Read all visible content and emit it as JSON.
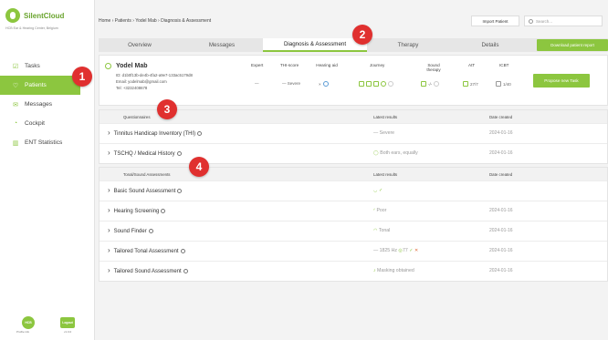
{
  "app": {
    "name": "SilentCloud",
    "subtitle": "HCB Ear & Hearing Center, Belgium"
  },
  "sidebar": {
    "items": [
      {
        "label": "Tasks",
        "icon": "checklist-icon"
      },
      {
        "label": "Patients",
        "icon": "patients-icon",
        "active": true
      },
      {
        "label": "Messages",
        "icon": "messages-icon"
      },
      {
        "label": "Cockpit",
        "icon": "cockpit-icon"
      },
      {
        "label": "ENT Statistics",
        "icon": "statistics-icon"
      }
    ],
    "footer": {
      "avatar_text": "HCB",
      "avatar_caption": "Profile info",
      "logout_label": "Logout",
      "logout_caption": "v1.0.0"
    }
  },
  "header": {
    "breadcrumb": "Home › Patients › Yodel Mab › Diagnosis & Assessment",
    "import_label": "Import Patient",
    "search_placeholder": "Search..."
  },
  "tabs": [
    "Overview",
    "Messages",
    "Diagnosis & Assessment",
    "Therapy",
    "Details"
  ],
  "download_label": "Download patient report",
  "patient": {
    "name": "Yodel Mab",
    "id": "ID: d1b0f13b-de4b-4fa2-a9e7-133ac5179d8",
    "email": "Email: yodelmab@gmail.com",
    "tel": "Tel: +3232408678",
    "expert_label": "Expert",
    "expert_value": "—",
    "thi_label": "THI-score",
    "thi_value": "— Severe",
    "hearing_label": "Hearing aid",
    "journey_label": "Journey",
    "sound_label": "Sound therapy",
    "sound_value": "-/-",
    "att_label": "AtT",
    "att_value": "27/7",
    "icbt_label": "ICBT",
    "icbt_value": "1/40",
    "task_button": "Propose new Task"
  },
  "questionnaires": {
    "headers": [
      "Questionnaires",
      "Latest results",
      "Date created"
    ],
    "rows": [
      {
        "name": "Tinnitus Handicap Inventory (THI)",
        "result": "— Severe",
        "date": "2024-01-16"
      },
      {
        "name": "TSCHQ / Medical History",
        "result": "Both ears, equally",
        "date": "2024-01-16"
      }
    ]
  },
  "tonal": {
    "headers": [
      "Tonal/Sound Assessments",
      "Latest results",
      "Date created"
    ],
    "rows": [
      {
        "name": "Basic Sound Assessment",
        "result": "✓",
        "date": ""
      },
      {
        "name": "Hearing Screening",
        "result": "Poor",
        "date": "2024-01-16"
      },
      {
        "name": "Sound Finder",
        "result": "Tonal",
        "date": "2024-01-16"
      },
      {
        "name": "Tailored Tonal Assessment",
        "result": "1825 Hz",
        "result2": "77",
        "date": "2024-01-16"
      },
      {
        "name": "Tailored Sound Assessment",
        "result": "Masking obtained",
        "date": "2024-01-16"
      }
    ]
  },
  "badges": [
    "1",
    "2",
    "3",
    "4"
  ],
  "colors": {
    "accent": "#8cc63f",
    "badge": "#e0302f"
  }
}
